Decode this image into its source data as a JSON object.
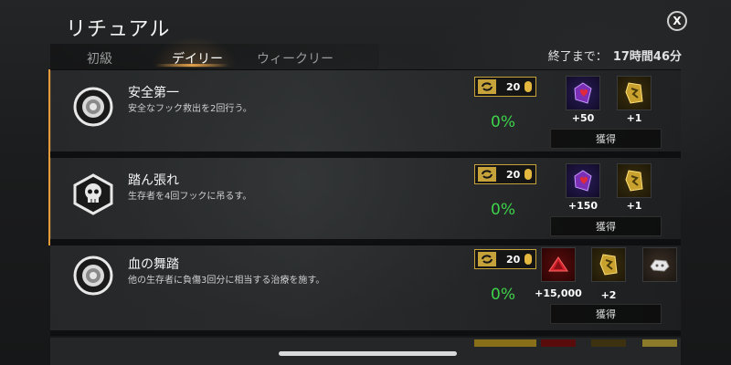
{
  "header": {
    "title": "リチュアル",
    "close_label": "X"
  },
  "tabs": [
    {
      "label": "初級"
    },
    {
      "label": "デイリー"
    },
    {
      "label": "ウィークリー"
    }
  ],
  "timer": {
    "label": "終了まで：",
    "value": "17時間46分"
  },
  "rituals": [
    {
      "title": "安全第一",
      "description": "安全なフック救出を2回行う。",
      "emblem": "survivor-emblem-icon",
      "points": "20",
      "progress": "0%",
      "rewards": [
        {
          "icon": "iridescent-shard-icon",
          "amount": "+50"
        },
        {
          "icon": "rift-fragment-icon",
          "amount": "+1"
        }
      ],
      "claim_label": "獲得"
    },
    {
      "title": "踏ん張れ",
      "description": "生存者を4回フックに吊るす。",
      "emblem": "killer-skull-icon",
      "points": "20",
      "progress": "0%",
      "rewards": [
        {
          "icon": "iridescent-shard-icon",
          "amount": "+150"
        },
        {
          "icon": "rift-fragment-icon",
          "amount": "+1"
        }
      ],
      "claim_label": "獲得"
    },
    {
      "title": "血の舞踏",
      "description": "他の生存者に負傷3回分に相当する治療を施す。",
      "emblem": "survivor-emblem-icon",
      "points": "20",
      "progress": "0%",
      "rewards": [
        {
          "icon": "bloodpoints-icon",
          "amount": "+15,000"
        },
        {
          "icon": "rift-fragment-icon",
          "amount": "+2"
        },
        {
          "icon": "offering-icon",
          "amount": ""
        }
      ],
      "claim_label": "獲得"
    }
  ],
  "colors": {
    "accent": "#e39a3a",
    "progress": "#3fd34a",
    "points_border": "#c6a23a"
  }
}
